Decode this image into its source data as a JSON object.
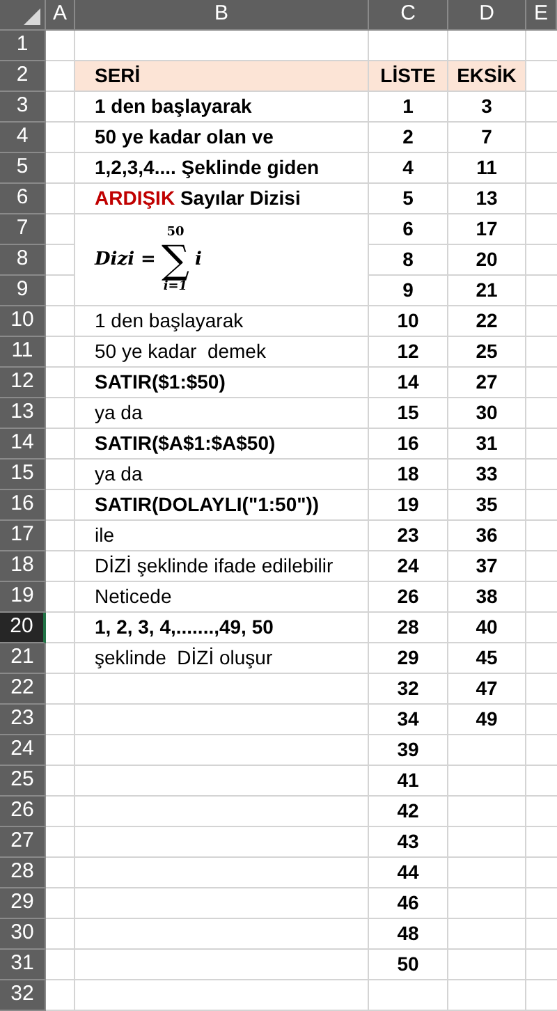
{
  "columns": [
    {
      "label": "A"
    },
    {
      "label": "B"
    },
    {
      "label": "C"
    },
    {
      "label": "D"
    },
    {
      "label": "E"
    }
  ],
  "rows": [
    {
      "number": "1",
      "kind": "data",
      "selected": false
    },
    {
      "number": "2",
      "kind": "heading",
      "selected": false,
      "b": [
        {
          "text": "SERİ"
        }
      ],
      "c": "LİSTE",
      "d": "EKSİK"
    },
    {
      "number": "3",
      "kind": "data",
      "selected": false,
      "b": [
        {
          "text": "1 den başlayarak"
        }
      ],
      "bold": true,
      "c": "1",
      "d": "3"
    },
    {
      "number": "4",
      "kind": "data",
      "selected": false,
      "b": [
        {
          "text": "50 ye kadar olan ve"
        }
      ],
      "bold": true,
      "c": "2",
      "d": "7"
    },
    {
      "number": "5",
      "kind": "data",
      "selected": false,
      "b": [
        {
          "text": "1,2,3,4.... Şeklinde giden"
        }
      ],
      "bold": true,
      "c": "4",
      "d": "11"
    },
    {
      "number": "6",
      "kind": "data",
      "selected": false,
      "b": [
        {
          "text": "ARDIŞIK",
          "color": "#c00000"
        },
        {
          "text": " Sayılar Dizisi"
        }
      ],
      "bold": true,
      "c": "5",
      "d": "13"
    },
    {
      "number": "7",
      "kind": "data",
      "selected": false,
      "formula": {
        "lhs": "Dizi =",
        "symbol": "∑",
        "upper": "50",
        "lower": "i=1",
        "body": "i"
      },
      "c": "6",
      "d": "17"
    },
    {
      "number": "8",
      "kind": "data",
      "selected": false,
      "c": "8",
      "d": "20"
    },
    {
      "number": "9",
      "kind": "data",
      "selected": false,
      "c": "9",
      "d": "21"
    },
    {
      "number": "10",
      "kind": "data",
      "selected": false,
      "b": [
        {
          "text": "1 den başlayarak"
        }
      ],
      "bold": false,
      "c": "10",
      "d": "22"
    },
    {
      "number": "11",
      "kind": "data",
      "selected": false,
      "b": [
        {
          "text": "50 ye kadar  demek"
        }
      ],
      "bold": false,
      "c": "12",
      "d": "25"
    },
    {
      "number": "12",
      "kind": "data",
      "selected": false,
      "b": [
        {
          "text": "SATIR($1:$50)"
        }
      ],
      "bold": true,
      "c": "14",
      "d": "27"
    },
    {
      "number": "13",
      "kind": "data",
      "selected": false,
      "b": [
        {
          "text": "ya da"
        }
      ],
      "bold": false,
      "c": "15",
      "d": "30"
    },
    {
      "number": "14",
      "kind": "data",
      "selected": false,
      "b": [
        {
          "text": "SATIR($A$1:$A$50)"
        }
      ],
      "bold": true,
      "c": "16",
      "d": "31"
    },
    {
      "number": "15",
      "kind": "data",
      "selected": false,
      "b": [
        {
          "text": "ya da"
        }
      ],
      "bold": false,
      "c": "18",
      "d": "33"
    },
    {
      "number": "16",
      "kind": "data",
      "selected": false,
      "b": [
        {
          "text": "SATIR(DOLAYLI(\"1:50\"))"
        }
      ],
      "bold": true,
      "c": "19",
      "d": "35"
    },
    {
      "number": "17",
      "kind": "data",
      "selected": false,
      "b": [
        {
          "text": "ile"
        }
      ],
      "bold": false,
      "c": "23",
      "d": "36"
    },
    {
      "number": "18",
      "kind": "data",
      "selected": false,
      "b": [
        {
          "text": "DİZİ şeklinde ifade edilebilir"
        }
      ],
      "bold": false,
      "c": "24",
      "d": "37"
    },
    {
      "number": "19",
      "kind": "data",
      "selected": false,
      "b": [
        {
          "text": "Neticede"
        }
      ],
      "bold": false,
      "c": "26",
      "d": "38"
    },
    {
      "number": "20",
      "kind": "data",
      "selected": true,
      "b": [
        {
          "text": "1, 2, 3, 4,.......,49, 50"
        }
      ],
      "bold": true,
      "c": "28",
      "d": "40"
    },
    {
      "number": "21",
      "kind": "data",
      "selected": false,
      "b": [
        {
          "text": "şeklinde  DİZİ oluşur"
        }
      ],
      "bold": false,
      "c": "29",
      "d": "45"
    },
    {
      "number": "22",
      "kind": "data",
      "selected": false,
      "c": "32",
      "d": "47"
    },
    {
      "number": "23",
      "kind": "data",
      "selected": false,
      "c": "34",
      "d": "49"
    },
    {
      "number": "24",
      "kind": "data",
      "selected": false,
      "c": "39"
    },
    {
      "number": "25",
      "kind": "data",
      "selected": false,
      "c": "41"
    },
    {
      "number": "26",
      "kind": "data",
      "selected": false,
      "c": "42"
    },
    {
      "number": "27",
      "kind": "data",
      "selected": false,
      "c": "43"
    },
    {
      "number": "28",
      "kind": "data",
      "selected": false,
      "c": "44"
    },
    {
      "number": "29",
      "kind": "data",
      "selected": false,
      "c": "46"
    },
    {
      "number": "30",
      "kind": "data",
      "selected": false,
      "c": "48"
    },
    {
      "number": "31",
      "kind": "data",
      "selected": false,
      "c": "50"
    },
    {
      "number": "32",
      "kind": "data",
      "selected": false
    }
  ]
}
